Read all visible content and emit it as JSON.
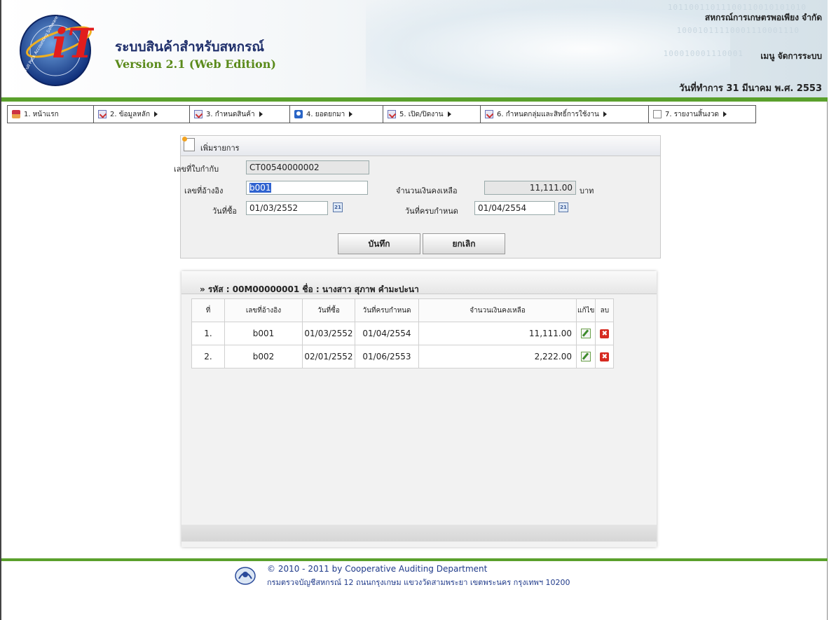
{
  "header": {
    "app_title": "ระบบสินค้าสำหรับสหกรณ์",
    "version": "Version 2.1 (Web Edition)",
    "coop_name": "สหกรณ์การเกษตรพอเพียง จำกัด",
    "menu_label": "เมนู จัดการระบบ",
    "work_date_label": "วันที่ทำการ",
    "work_date": "31 มีนาคม พ.ศ. 2553",
    "logo_text": "iT",
    "logo_ring_text": "Full Pack Accounting Software : FAS",
    "binary_1": "10110011011100110010101010",
    "binary_2": "10001011110001110001110",
    "binary_3": "100010001110001"
  },
  "menu": {
    "items": [
      {
        "label": "1. หน้าแรก",
        "icon": "home-icon",
        "has_submenu": false
      },
      {
        "label": "2. ข้อมูลหลัก",
        "icon": "checklist-icon",
        "has_submenu": true
      },
      {
        "label": "3. กำหนดสินค้า",
        "icon": "checklist-icon",
        "has_submenu": true
      },
      {
        "label": "4. ยอดยกมา",
        "icon": "info-icon",
        "has_submenu": true
      },
      {
        "label": "5. เปิด/ปิดงาน",
        "icon": "checklist-icon",
        "has_submenu": true
      },
      {
        "label": "6. กำหนดกลุ่มและสิทธิ์การใช้งาน",
        "icon": "checklist-icon",
        "has_submenu": true
      },
      {
        "label": "7. รายงานสิ้นงวด",
        "icon": "page-icon",
        "has_submenu": true
      }
    ]
  },
  "form": {
    "title": "เพิ่มรายการ",
    "invoice_label": "เลขที่ใบกำกับ",
    "invoice_value": "CT00540000002",
    "ref_label": "เลขที่อ้างอิง",
    "ref_value": "b001",
    "balance_label": "จำนวนเงินคงเหลือ",
    "balance_value": "11,111.00",
    "balance_unit": "บาท",
    "buy_date_label": "วันที่ซื้อ",
    "buy_date_value": "01/03/2552",
    "due_date_label": "วันที่ครบกำหนด",
    "due_date_value": "01/04/2554",
    "calendar_icon_text": "21",
    "save_label": "บันทึก",
    "cancel_label": "ยกเลิก"
  },
  "grid": {
    "title": "» รหัส : 00M00000001 ชื่อ : นางสาว สุภาพ คำมะปะนา",
    "columns": [
      "ที่",
      "เลขที่อ้างอิง",
      "วันที่ซื้อ",
      "วันที่ครบกำหนด",
      "จำนวนเงินคงเหลือ",
      "แก้ไข",
      "ลบ"
    ],
    "rows": [
      {
        "no": "1.",
        "ref": "b001",
        "buy_date": "01/03/2552",
        "due_date": "01/04/2554",
        "amount": "11,111.00"
      },
      {
        "no": "2.",
        "ref": "b002",
        "buy_date": "02/01/2552",
        "due_date": "01/06/2553",
        "amount": "2,222.00"
      }
    ],
    "delete_icon_text": "✖"
  },
  "footer": {
    "copyright": "© 2010 - 2011 by Cooperative Auditing Department",
    "address": "กรมตรวจบัญชีสหกรณ์ 12 ถนนกรุงเกษม แขวงวัดสามพระยา เขตพระนคร กรุงเทพฯ 10200"
  },
  "colors": {
    "brand_green": "#5aa02c",
    "title_navy": "#1f2f6b",
    "version_green": "#5a8a1a",
    "selection_blue": "#2f63d0",
    "delete_red": "#d62a20"
  }
}
